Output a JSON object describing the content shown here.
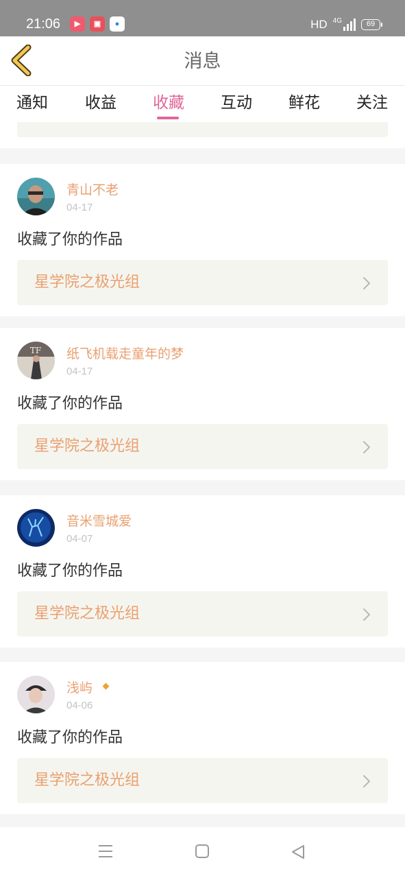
{
  "status_bar": {
    "time": "21:06",
    "apps": [
      {
        "icon": "video-app-icon",
        "glyph": "▶",
        "color": "#f05a6e"
      },
      {
        "icon": "recorder-app-icon",
        "glyph": "▣",
        "color": "#e8505b"
      },
      {
        "icon": "browser-app-icon",
        "glyph": "●",
        "color": "#2a86e0"
      }
    ],
    "hd_label": "HD",
    "network_label": "4G",
    "battery": "69"
  },
  "header": {
    "title": "消息",
    "back_icon": "chevron-left-icon",
    "accent_color": "#f2c94c"
  },
  "tabs": [
    {
      "label": "通知",
      "active": false
    },
    {
      "label": "收益",
      "active": false
    },
    {
      "label": "收藏",
      "active": true
    },
    {
      "label": "互动",
      "active": false
    },
    {
      "label": "鲜花",
      "active": false
    },
    {
      "label": "关注",
      "active": false
    }
  ],
  "colors": {
    "active_tab": "#e0669a",
    "username": "#e9a070",
    "work_title": "#e9a070",
    "work_bg": "#f5f5ef",
    "badge": "#f0a030"
  },
  "cards": [
    {
      "username": "青山不老",
      "date": "04-17",
      "action": "收藏了你的作品",
      "work_title": "星学院之极光组",
      "badge": false,
      "avatar": "person-photo"
    },
    {
      "username": "纸飞机载走童年的梦",
      "date": "04-17",
      "action": "收藏了你的作品",
      "work_title": "星学院之极光组",
      "badge": false,
      "avatar": "tfboys-photo"
    },
    {
      "username": "音米雪城爱",
      "date": "04-07",
      "action": "收藏了你的作品",
      "work_title": "星学院之极光组",
      "badge": false,
      "avatar": "blue-deer-art"
    },
    {
      "username": "浅屿",
      "date": "04-06",
      "action": "收藏了你的作品",
      "work_title": "星学院之极光组",
      "badge": true,
      "avatar": "boy-cap-photo"
    }
  ],
  "nav_bar": {
    "buttons": [
      "menu-icon",
      "home-icon",
      "back-icon"
    ]
  }
}
